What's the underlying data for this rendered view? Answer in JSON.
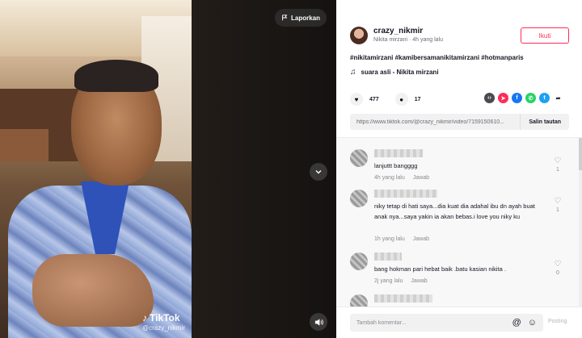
{
  "video": {
    "report_label": "Laporkan",
    "watermark_brand": "TikTok",
    "watermark_user": "@crazy_nikmir"
  },
  "author": {
    "username": "crazy_nikmir",
    "subline": "Nikita mirzani · 4h yang lalu",
    "follow_label": "Ikuti"
  },
  "post": {
    "caption": "#nikitamirzani #kamibersamanikitamirzani #hotmanparis",
    "sound": "suara asli - Nikita mirzani",
    "likes": "477",
    "comments_count": "17",
    "url": "https://www.tiktok.com/@crazy_nikmir/video/7159150610...",
    "copy_label": "Salin tautan"
  },
  "share_icons": [
    "embed-icon",
    "send-icon",
    "facebook-icon",
    "whatsapp-icon",
    "twitter-icon",
    "share-arrow-icon"
  ],
  "comments": [
    {
      "text": "lanjuttt bangggg",
      "time": "4h yang lalu",
      "reply": "Jawab",
      "likes": "1"
    },
    {
      "text": "niky tetap di hati saya...dia kuat dia adahal ibu dn ayah buat anak nya...saya yakin ia akan bebas.i love you niky ku",
      "time": "1h yang lalu",
      "reply": "Jawab",
      "likes": "1"
    },
    {
      "text": "bang hokman pari hebat baik .batu kasian nikita .",
      "time": "2j yang lalu",
      "reply": "Jawab",
      "likes": "0"
    }
  ],
  "composer": {
    "placeholder": "Tambah komentar...",
    "post_label": "Posting"
  },
  "colors": {
    "accent": "#fe2c55",
    "facebook": "#1877f2",
    "whatsapp": "#25d366",
    "twitter": "#1da1f2",
    "embed": "#4a4a52",
    "send": "#fe2c55"
  }
}
